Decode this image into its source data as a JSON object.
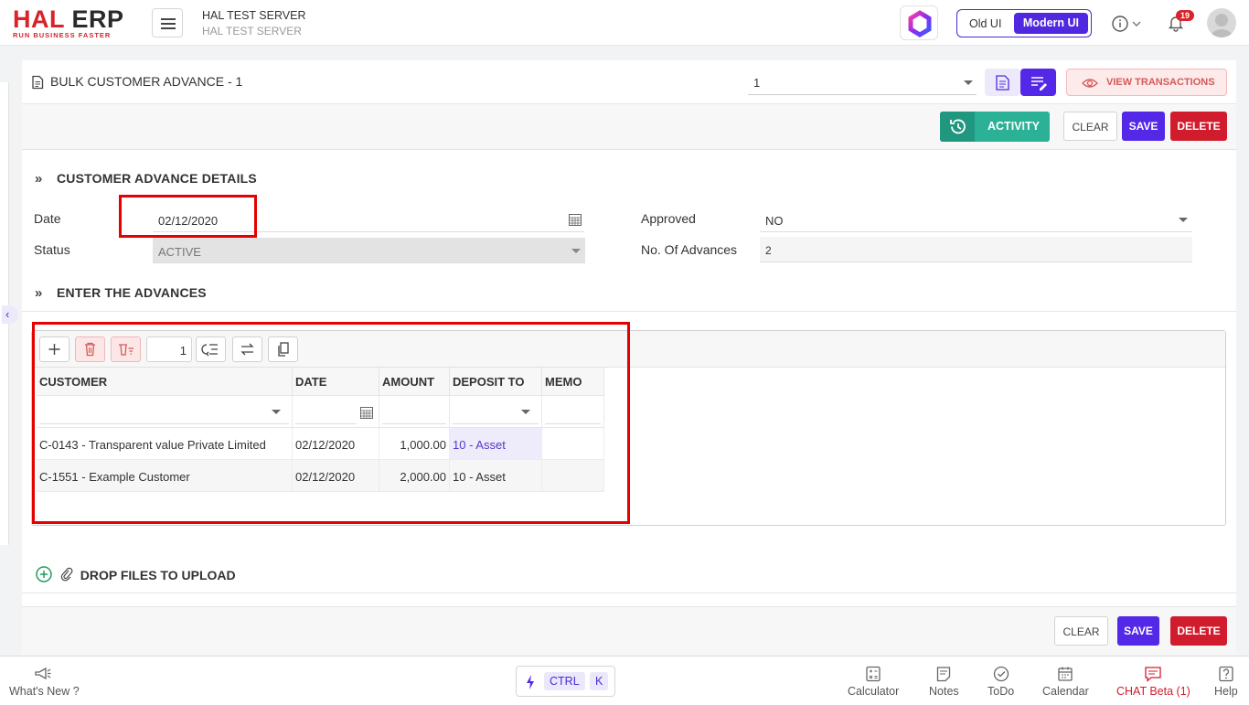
{
  "header": {
    "logo_text_red": "HAL",
    "logo_text_dark": " ERP",
    "logo_tagline": "RUN BUSINESS FASTER",
    "server_name": "HAL TEST SERVER",
    "server_sub": "HAL TEST SERVER",
    "old_ui_label": "Old UI",
    "modern_ui_label": "Modern UI",
    "notification_count": "19"
  },
  "page": {
    "title": "BULK CUSTOMER ADVANCE - 1",
    "record_select_value": "1",
    "view_transactions_label": "VIEW TRANSACTIONS",
    "activity_label": "ACTIVITY",
    "clear_label": "CLEAR",
    "save_label": "SAVE",
    "delete_label": "DELETE"
  },
  "details": {
    "section_title": "CUSTOMER ADVANCE DETAILS",
    "date_label": "Date",
    "date_value": "02/12/2020",
    "status_label": "Status",
    "status_value": "ACTIVE",
    "approved_label": "Approved",
    "approved_value": "NO",
    "advances_label": "No. Of Advances",
    "advances_value": "2"
  },
  "advances": {
    "section_title": "ENTER THE ADVANCES",
    "row_count_value": "1",
    "columns": [
      "CUSTOMER",
      "DATE",
      "AMOUNT",
      "DEPOSIT TO",
      "MEMO"
    ],
    "rows": [
      {
        "customer": "C-0143 - Transparent value Private Limited",
        "date": "02/12/2020",
        "amount": "1,000.00",
        "deposit_to": "10 - Asset",
        "memo": ""
      },
      {
        "customer": "C-1551 - Example Customer",
        "date": "02/12/2020",
        "amount": "2,000.00",
        "deposit_to": "10 - Asset",
        "memo": ""
      }
    ]
  },
  "upload": {
    "label": "DROP FILES TO UPLOAD"
  },
  "footer": {
    "whats_new": "What's New ?",
    "ctrl_key": "CTRL",
    "k_key": "K",
    "calculator": "Calculator",
    "notes": "Notes",
    "todo": "ToDo",
    "calendar": "Calendar",
    "chat": "CHAT Beta (1)",
    "help": "Help"
  },
  "colors": {
    "brand_red": "#d8232a",
    "primary_purple": "#5328e6",
    "activity_green": "#2bb196",
    "delete_red": "#d11c2e"
  }
}
